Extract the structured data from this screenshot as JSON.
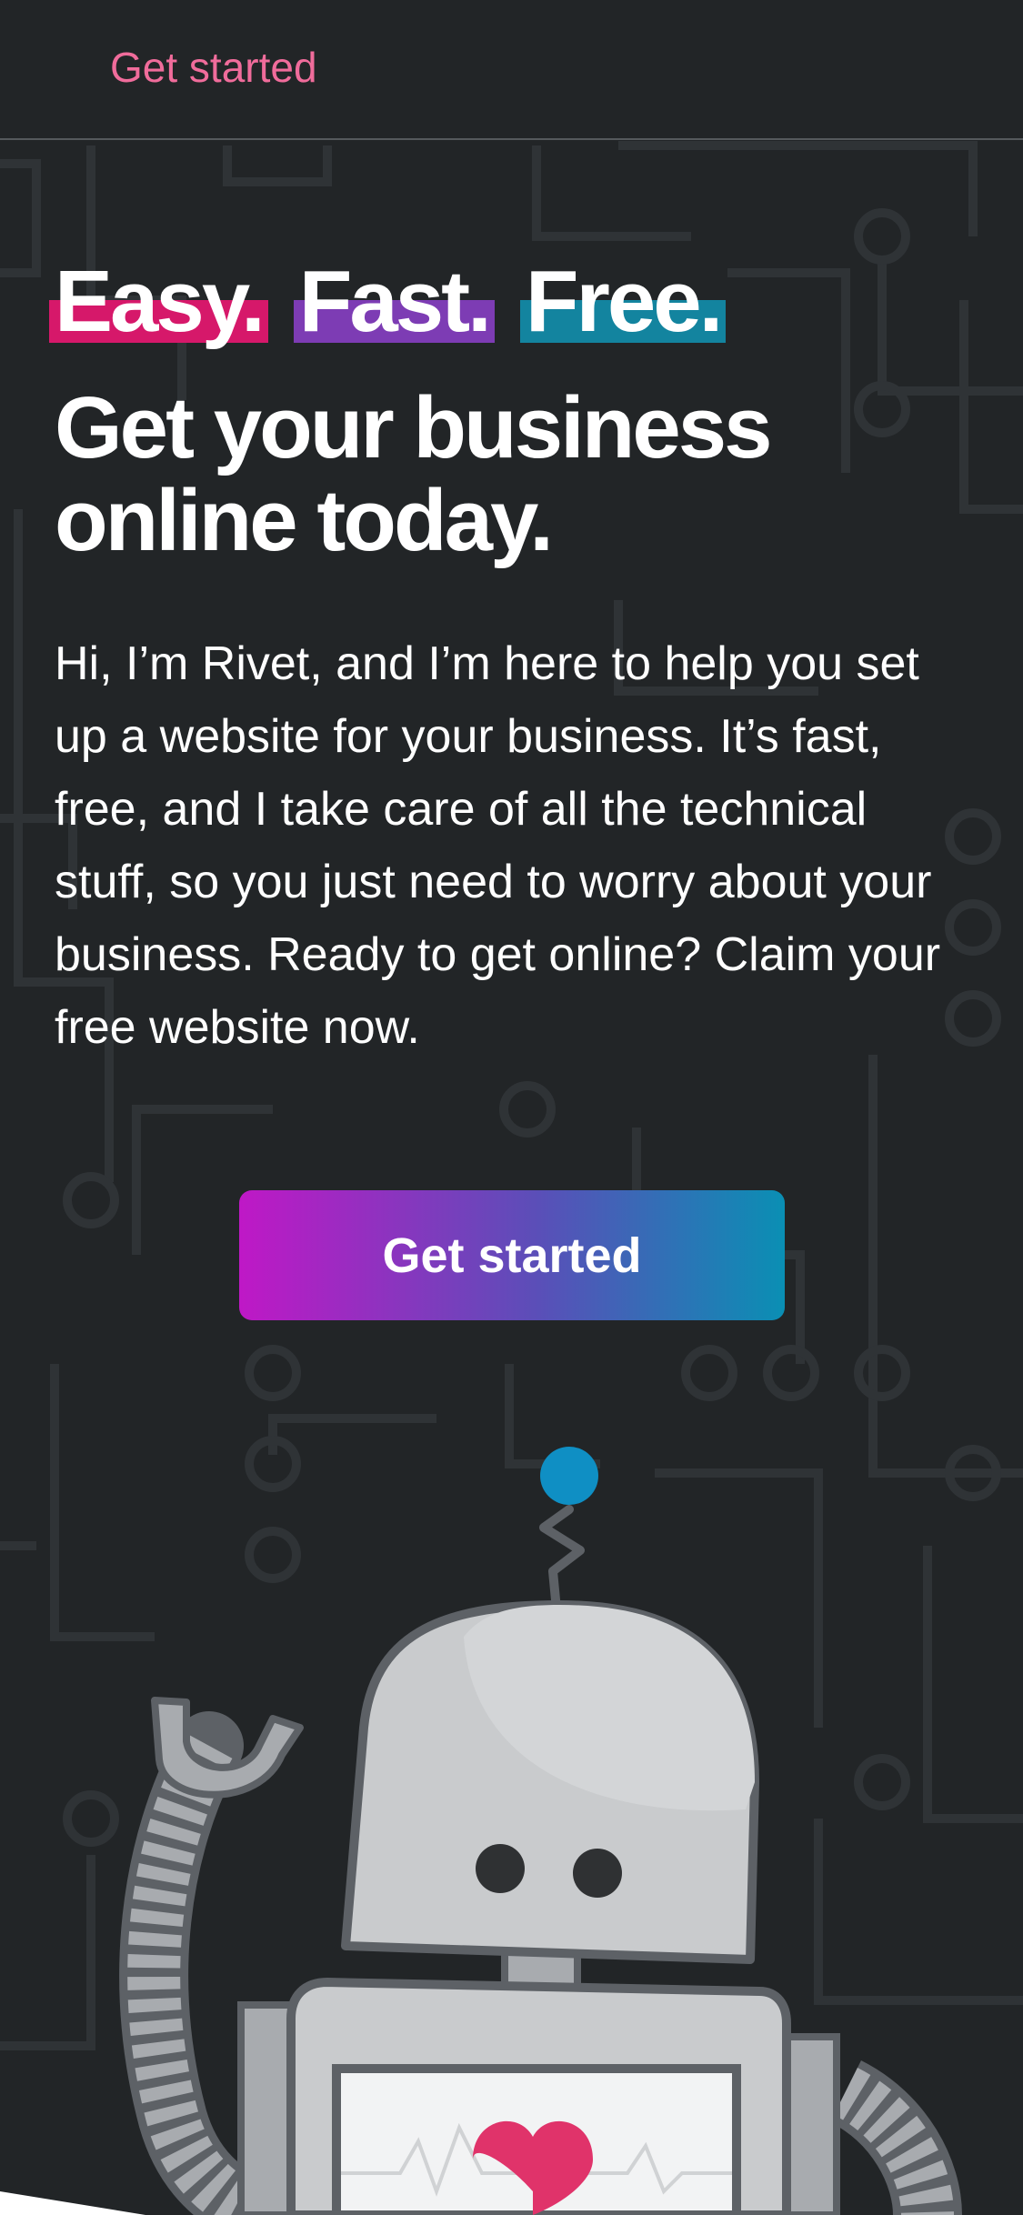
{
  "header": {
    "link_label": "Get started"
  },
  "hero": {
    "taglines": [
      "Easy.",
      "Fast.",
      "Free."
    ],
    "tagline_colors": [
      "#d6186a",
      "#7d3cb4",
      "#13849f"
    ],
    "headline": "Get your business online today.",
    "intro": "Hi, I’m Rivet, and I’m here to help you set up a website for your business. It’s fast, free, and I take care of all the technical stuff, so you just need to worry about your business. Ready to get online? Claim your free website now.",
    "cta_label": "Get started"
  },
  "colors": {
    "background": "#222527",
    "link": "#f06c9b",
    "cta_gradient_start": "#bf18c6",
    "cta_gradient_end": "#0a8fb4",
    "heart": "#e0336a",
    "antenna_tip": "#0f8fc4"
  }
}
